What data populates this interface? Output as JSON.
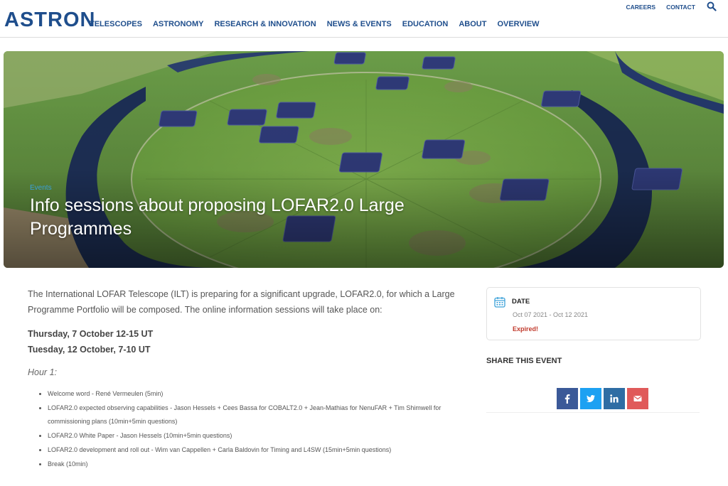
{
  "header": {
    "logo": "ASTRON",
    "nav": [
      "TELESCOPES",
      "ASTRONOMY",
      "RESEARCH & INNOVATION",
      "NEWS & EVENTS",
      "EDUCATION",
      "ABOUT",
      "OVERVIEW"
    ],
    "utility": [
      "CAREERS",
      "CONTACT"
    ],
    "search_icon": "search-icon"
  },
  "hero": {
    "category": "Events",
    "title": "Info sessions about proposing LOFAR2.0 Large Programmes"
  },
  "content": {
    "intro": "The International LOFAR Telescope (ILT) is preparing for a significant upgrade, LOFAR2.0, for which a Large Programme Portfolio will be composed. The online information sessions will take place on:",
    "dates": [
      "Thursday, 7 October 12-15 UT",
      "Tuesday, 12 October, 7-10 UT"
    ],
    "hour": "Hour 1:",
    "agenda": [
      "Welcome word - René Vermeulen (5min)",
      "LOFAR2.0 expected observing capabilities - Jason Hessels + Cees Bassa for COBALT2.0 + Jean-Mathias for NenuFAR + Tim Shimwell for commissioning plans (10min+5min questions)",
      "LOFAR2.0 White Paper - Jason Hessels (10min+5min questions)",
      "LOFAR2.0 development and roll out - Wim van Cappellen + Carla Baldovin for Timing and L4SW (15min+5min questions)",
      "Break (10min)"
    ]
  },
  "sidebar": {
    "date_label": "DATE",
    "date_range": "Oct 07 2021 - Oct 12 2021",
    "status": "Expired!",
    "share_title": "SHARE THIS EVENT",
    "share_icons": [
      "facebook-icon",
      "twitter-icon",
      "linkedin-icon",
      "email-icon"
    ]
  },
  "colors": {
    "brand": "#1f4e8c",
    "accent": "#3aa0d8",
    "expired": "#c0392b",
    "facebook": "#3b5998",
    "twitter": "#1da1f2",
    "linkedin": "#2e6da4",
    "email": "#e05a5a"
  }
}
